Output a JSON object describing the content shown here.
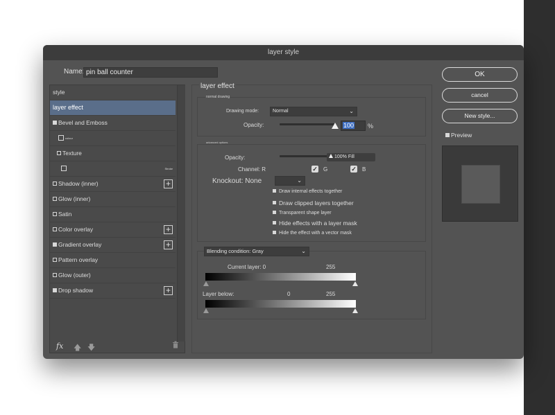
{
  "window": {
    "title": "layer style"
  },
  "name_field": {
    "label": "Name:",
    "value": "pin ball counter"
  },
  "sidebar": {
    "header": "style",
    "items": [
      {
        "label": "layer effect",
        "checkbox": "none",
        "plus": false
      },
      {
        "label": "Bevel and Emboss",
        "checkbox": "filled",
        "plus": false
      },
      {
        "label": "colour",
        "checkbox": "empty",
        "plus": false
      },
      {
        "label": "Texture",
        "checkbox": "empty",
        "plus": false
      },
      {
        "label": "Stroke",
        "checkbox": "empty",
        "plus": false
      },
      {
        "label": "Shadow (inner)",
        "checkbox": "empty",
        "plus": true
      },
      {
        "label": "Glow (inner)",
        "checkbox": "empty",
        "plus": false
      },
      {
        "label": "Satin",
        "checkbox": "empty",
        "plus": false
      },
      {
        "label": "Color overlay",
        "checkbox": "empty",
        "plus": true
      },
      {
        "label": "Gradient overlay",
        "checkbox": "filled",
        "plus": true
      },
      {
        "label": "Pattern overlay",
        "checkbox": "empty",
        "plus": false
      },
      {
        "label": "Glow (outer)",
        "checkbox": "empty",
        "plus": false
      },
      {
        "label": "Drop shadow",
        "checkbox": "filled",
        "plus": true
      }
    ],
    "footer": {
      "fx_label": "fx"
    }
  },
  "layer_effect": {
    "title": "layer effect",
    "normal_group": {
      "caption": "normal drawing",
      "drawing_mode_label": "Drawing mode:",
      "drawing_mode_value": "Normal",
      "opacity_label": "Opacity:",
      "opacity_value": "100",
      "opacity_unit": "%",
      "opacity_fraction": 1.0
    },
    "advanced_group": {
      "caption": "advanced options",
      "opacity_label": "Opacity:",
      "fill_value": "100% Fill",
      "channel_label": "Channel: R",
      "channel_g": "G",
      "channel_b": "B",
      "knockout_label": "Knockout: None",
      "options": [
        {
          "label": "Draw internal effects together",
          "checked": true
        },
        {
          "label": "Draw clipped layers together",
          "checked": true
        },
        {
          "label": "Transparent shape layer",
          "checked": true
        },
        {
          "label": "Hide effects with a layer mask",
          "checked": true
        },
        {
          "label": "Hide the effect with a vector mask",
          "checked": true
        }
      ]
    },
    "blending": {
      "condition_label": "Blending condition: Gray",
      "current_layer_label": "Current layer: 0",
      "current_layer_max": "255",
      "layer_below_label": "Layer below:",
      "layer_below_min": "0",
      "layer_below_max": "255"
    }
  },
  "buttons": {
    "ok": "OK",
    "cancel": "cancel",
    "new_style": "New style..."
  },
  "preview": {
    "label": "Preview",
    "checked": true
  }
}
